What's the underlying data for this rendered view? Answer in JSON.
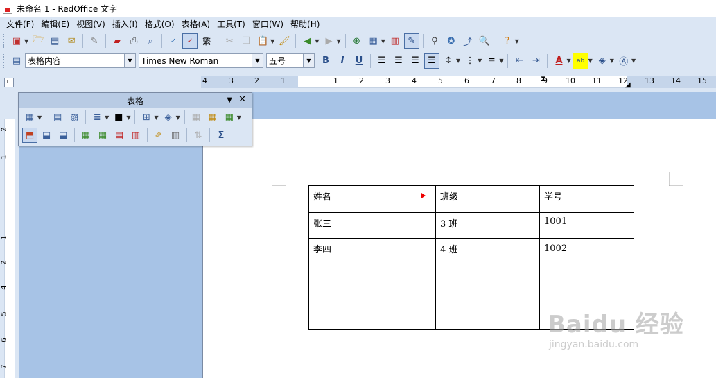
{
  "window": {
    "title": "未命名 1 - RedOffice 文字"
  },
  "menu": [
    "文件(F)",
    "编辑(E)",
    "视图(V)",
    "插入(I)",
    "格式(O)",
    "表格(A)",
    "工具(T)",
    "窗口(W)",
    "帮助(H)"
  ],
  "format_bar": {
    "paragraph_style": "表格内容",
    "font_name": "Times New Roman",
    "font_size": "五号"
  },
  "ruler": {
    "left_numbers": [
      "4",
      "3",
      "2",
      "1"
    ],
    "right_numbers": [
      "1",
      "2",
      "3",
      "4",
      "5",
      "6",
      "7",
      "8",
      "9",
      "10",
      "11",
      "12",
      "13",
      "14",
      "15"
    ],
    "vertical_numbers": [
      "2",
      "1",
      "1",
      "2",
      "3",
      "4",
      "5",
      "6",
      "7"
    ]
  },
  "table_toolbar": {
    "title": "表格"
  },
  "document_table": {
    "rows": [
      [
        "姓名",
        "班级",
        "学号"
      ],
      [
        "张三",
        "3 班",
        "1001"
      ],
      [
        "李四",
        "4 班",
        "1002"
      ]
    ]
  },
  "watermark": {
    "main": "Baidu 经验",
    "sub": "jingyan.baidu.com"
  },
  "colors": {
    "chrome": "#dbe6f4",
    "doc_background": "#a7c3e6",
    "marker": "#e00000"
  }
}
